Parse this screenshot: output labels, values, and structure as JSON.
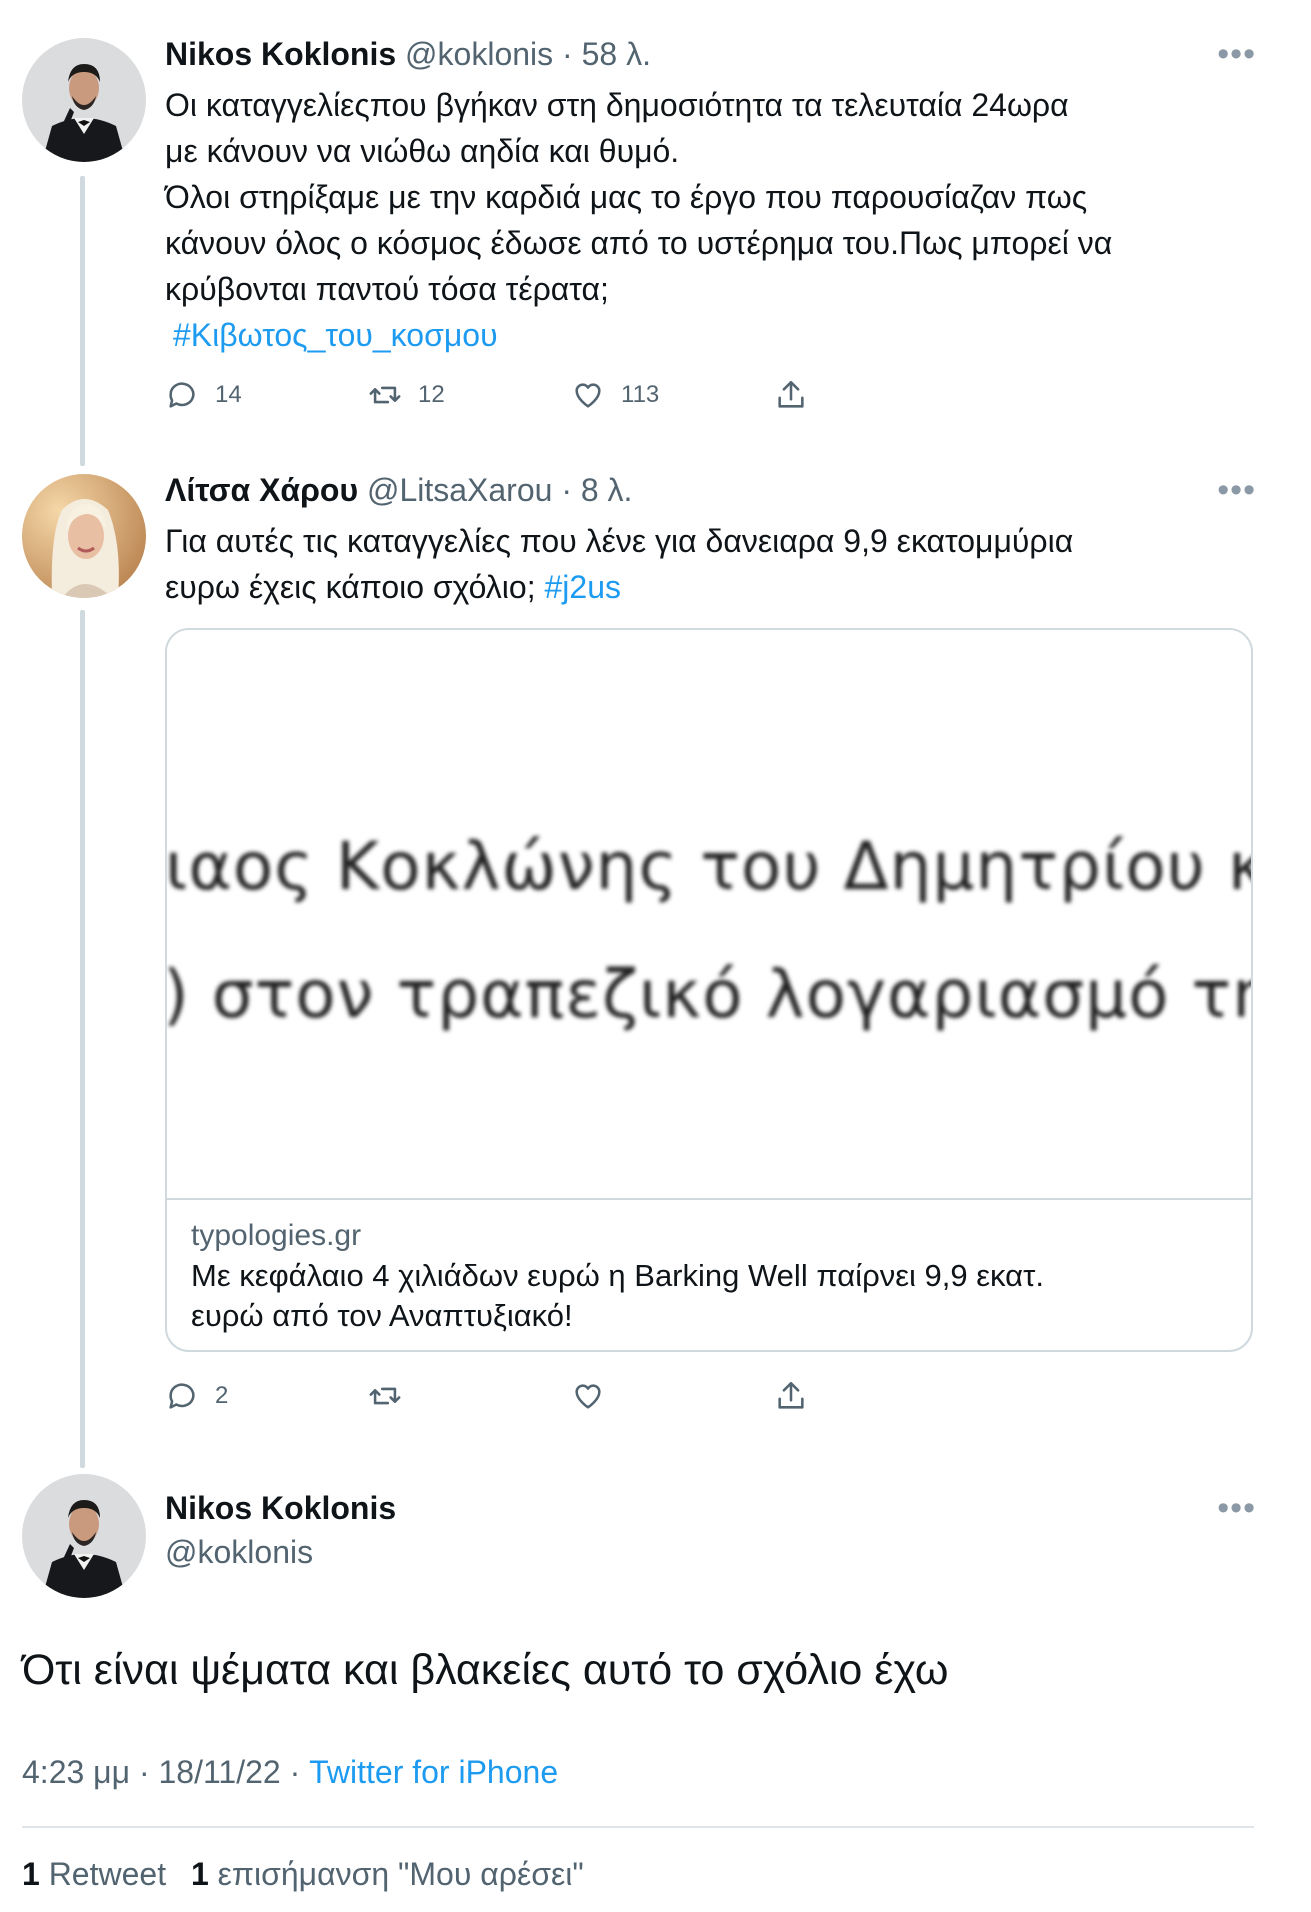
{
  "colors": {
    "link": "#1d9bf0",
    "text": "#0f1419",
    "secondary": "#536471",
    "border": "#cfd9de"
  },
  "tweet1": {
    "name": "Nikos Koklonis",
    "handle": "@koklonis",
    "time": "· 58 λ.",
    "more": "•••",
    "lines": [
      "Οι καταγγελίεςπου βγήκαν στη δημοσιότητα τα τελευταία 24ωρα",
      "με κάνουν να νιώθω αηδία και θυμό.",
      "Όλοι στηρίξαμε με την καρδιά μας το έργο που παρουσίαζαν πως",
      "κάνουν όλος ο κόσμος έδωσε από το υστέρημα του.Πως μπορεί να",
      "κρύβονται παντού  τόσα τέρατα;"
    ],
    "hashtag": "#Κιβωτος_του_κοσμου",
    "replies": "14",
    "retweets": "12",
    "likes": "113"
  },
  "tweet2": {
    "name": "Λίτσα Χάρου",
    "handle": "@LitsaXarou",
    "time": "· 8 λ.",
    "more": "•••",
    "line1": "Για αυτές τις καταγγελίες που λένε για δανειαρα 9,9 εκατομμύρια",
    "line2": "ευρω έχεις κάποιο σχόλιο; ",
    "hashtag": "#j2us",
    "card": {
      "image_line1": "ιαος Κοκλώνης του Δημητρίου κατέβ",
      "image_line2": ") στον τραπεζικό λογαριασμό της εται",
      "domain": "typologies.gr",
      "title_line1": "Με κεφάλαιο 4 χιλιάδων ευρώ η Barking Well παίρνει 9,9 εκατ.",
      "title_line2": "ευρώ από τον Αναπτυξιακό!"
    },
    "replies": "2",
    "retweets": "",
    "likes": ""
  },
  "main_tweet": {
    "name": "Nikos Koklonis",
    "handle": "@koklonis",
    "more": "•••",
    "text": "Ότι είναι ψέματα και βλακείες αυτό το σχόλιο έχω",
    "time": "4:23 μμ · 18/11/22 · ",
    "source": "Twitter for iPhone",
    "retweet_count": "1",
    "retweet_label": " Retweet",
    "like_count": "1",
    "like_label": " επισήμανση \"Μου αρέσει\""
  },
  "icons": {
    "reply": "reply-icon",
    "retweet": "retweet-icon",
    "like": "heart-icon",
    "share": "share-icon",
    "more": "more-dots-icon"
  }
}
